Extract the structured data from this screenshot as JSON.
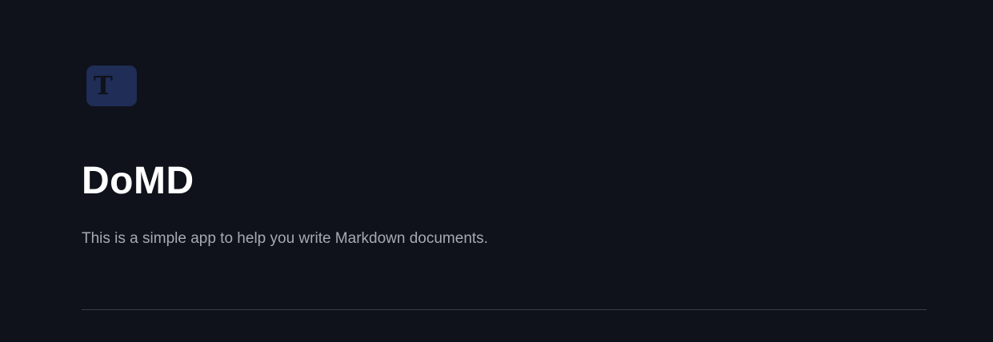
{
  "app": {
    "logo_glyph": "T",
    "title": "DoMD",
    "description": "This is a simple app to help you write Markdown documents."
  },
  "colors": {
    "background": "#0f121a",
    "logo_background": "#1f2d57",
    "title_text": "#ffffff",
    "description_text": "#a7a9b0",
    "divider": "#3b3e46"
  },
  "icons": {
    "logo": "text-format-icon"
  }
}
